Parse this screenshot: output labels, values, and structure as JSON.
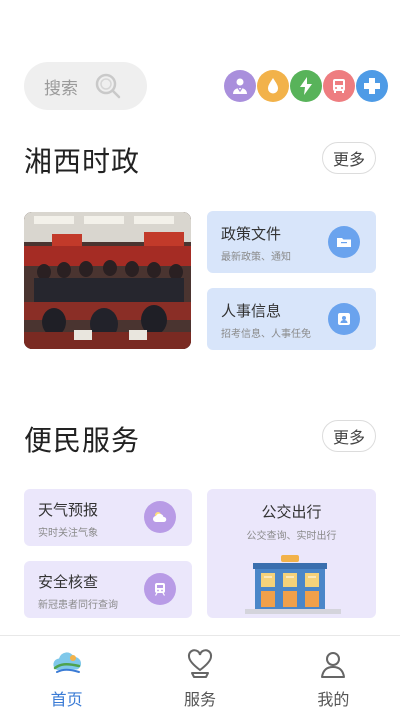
{
  "search": {
    "placeholder": "搜索"
  },
  "quick_icons": [
    {
      "name": "doctor-icon",
      "color": "#a98fdc"
    },
    {
      "name": "water-drop-icon",
      "color": "#f2b24a"
    },
    {
      "name": "lightning-icon",
      "color": "#58b35a"
    },
    {
      "name": "bus-icon",
      "color": "#ee7d80"
    },
    {
      "name": "medical-cross-icon",
      "color": "#4e9be6"
    }
  ],
  "section_politics": {
    "title": "湘西时政",
    "more_label": "更多",
    "cards": [
      {
        "title": "政策文件",
        "subtitle": "最新政策、通知",
        "icon": "folder-icon",
        "icon_color": "#6aa3ee"
      },
      {
        "title": "人事信息",
        "subtitle": "招考信息、人事任免",
        "icon": "id-card-icon",
        "icon_color": "#6aa3ee"
      }
    ]
  },
  "section_services": {
    "title": "便民服务",
    "more_label": "更多",
    "cards": [
      {
        "title": "天气预报",
        "subtitle": "实时关注气象",
        "icon": "weather-icon",
        "icon_color": "#b89be6"
      },
      {
        "title": "安全核查",
        "subtitle": "新冠患者同行查询",
        "icon": "train-icon",
        "icon_color": "#b89be6"
      },
      {
        "title": "公交出行",
        "subtitle": "公交查询、实时出行",
        "icon": "bus-station-illustration"
      }
    ]
  },
  "tabbar": {
    "tabs": [
      {
        "label": "首页",
        "active": true
      },
      {
        "label": "服务",
        "active": false
      },
      {
        "label": "我的",
        "active": false
      }
    ]
  },
  "colors": {
    "accent": "#3a7bd5",
    "card_blue": "#d8e5fa",
    "card_purple": "#ebe7fb"
  }
}
